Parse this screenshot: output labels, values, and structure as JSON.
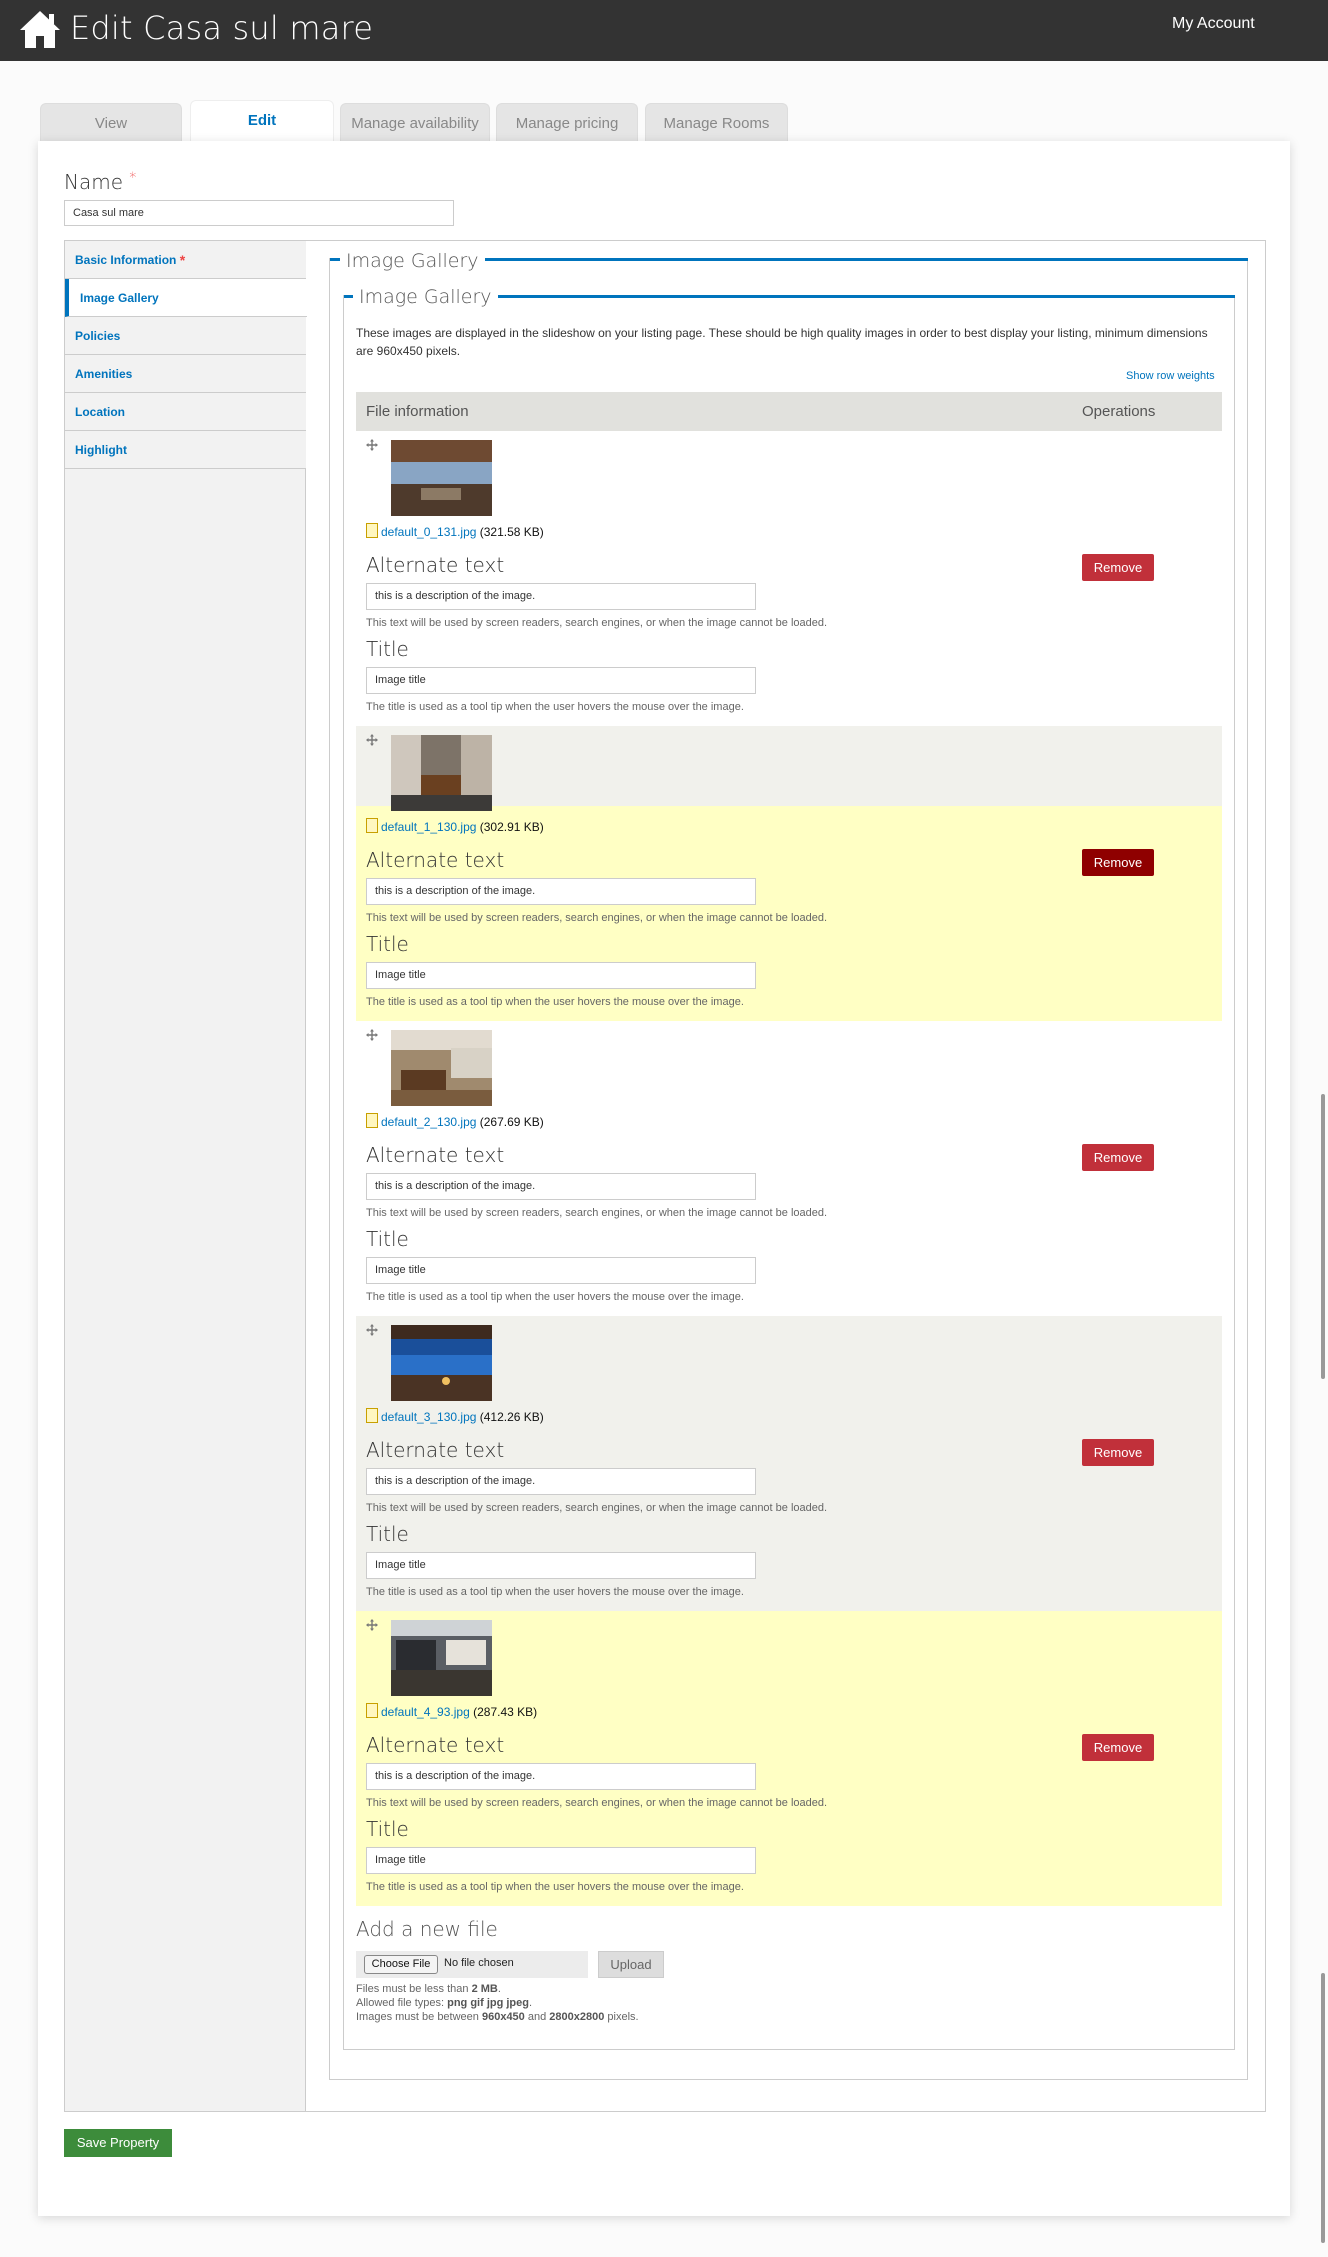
{
  "header": {
    "title": "Edit Casa sul mare",
    "account": "My Account"
  },
  "tabs": [
    "View",
    "Edit",
    "Manage availability",
    "Manage pricing",
    "Manage Rooms"
  ],
  "name_field": {
    "label": "Name",
    "required": "*",
    "value": "Casa sul mare"
  },
  "sidebar": {
    "items": [
      {
        "label": "Basic Information",
        "required": "*"
      },
      {
        "label": "Image Gallery"
      },
      {
        "label": "Policies"
      },
      {
        "label": "Amenities"
      },
      {
        "label": "Location"
      },
      {
        "label": "Highlight"
      }
    ]
  },
  "gallery": {
    "outer_legend": "Image Gallery",
    "inner_legend": "Image Gallery",
    "description": "These images are displayed in the slideshow on your listing page. These should be high quality images in order to best display your listing, minimum dimensions are 960x450 pixels.",
    "show_row_weights": "Show row weights",
    "columns": [
      "File information",
      "Operations"
    ],
    "alt_label": "Alternate text",
    "alt_help": "This text will be used by screen readers, search engines, or when the image cannot be loaded.",
    "title_label": "Title",
    "title_help": "The title is used as a tool tip when the user hovers the mouse over the image.",
    "remove_label": "Remove",
    "rows": [
      {
        "file": "default_0_131.jpg",
        "size": "(321.58 KB)",
        "alt": "this is a description of the image.",
        "title": "Image title"
      },
      {
        "file": "default_1_130.jpg",
        "size": "(302.91 KB)",
        "alt": "this is a description of the image.",
        "title": "Image title"
      },
      {
        "file": "default_2_130.jpg",
        "size": "(267.69 KB)",
        "alt": "this is a description of the image.",
        "title": "Image title"
      },
      {
        "file": "default_3_130.jpg",
        "size": "(412.26 KB)",
        "alt": "this is a description of the image.",
        "title": "Image title"
      },
      {
        "file": "default_4_93.jpg",
        "size": "(287.43 KB)",
        "alt": "this is a description of the image.",
        "title": "Image title"
      }
    ],
    "add_file": {
      "heading": "Add a new file",
      "choose": "Choose File",
      "no_file": "No file chosen",
      "upload": "Upload",
      "help1_pre": "Files must be less than ",
      "help1_bold": "2 MB",
      "help1_post": ".",
      "help2_pre": "Allowed file types: ",
      "help2_bold": "png gif jpg jpeg",
      "help2_post": ".",
      "help3_pre": "Images must be between ",
      "help3_b1": "960x450",
      "help3_mid": " and ",
      "help3_b2": "2800x2800",
      "help3_post": " pixels."
    }
  },
  "save_button": "Save Property"
}
